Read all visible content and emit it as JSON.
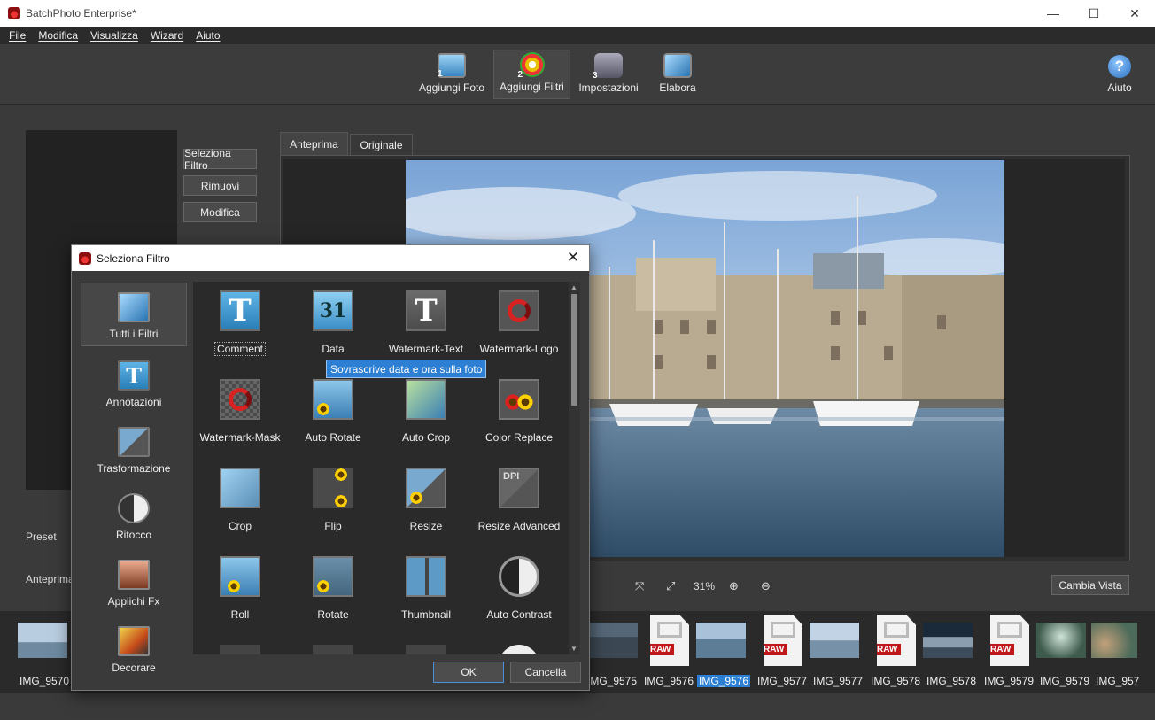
{
  "window": {
    "title": "BatchPhoto Enterprise*",
    "min": "—",
    "max": "☐",
    "close": "✕"
  },
  "menu": [
    "File",
    "Modifica",
    "Visualizza",
    "Wizard",
    "Aiuto"
  ],
  "toolbar": {
    "steps": [
      {
        "num": "1",
        "label": "Aggiungi Foto"
      },
      {
        "num": "2",
        "label": "Aggiungi Filtri"
      },
      {
        "num": "3",
        "label": "Impostazioni"
      },
      {
        "num": "",
        "label": "Elabora"
      }
    ],
    "help_label": "Aiuto",
    "help_glyph": "?"
  },
  "side_buttons": {
    "select": "Seleziona Filtro",
    "remove": "Rimuovi",
    "edit": "Modifica"
  },
  "labels": {
    "preset": "Preset",
    "preview": "Anteprima"
  },
  "tabs": [
    "Anteprima",
    "Originale"
  ],
  "zoom": {
    "fit1": "⤧",
    "fit2": "⤢",
    "percent": "31%",
    "zoom_in": "⊕",
    "zoom_out": "⊖"
  },
  "cambia_vista": "Cambia Vista",
  "thumbnails": [
    {
      "label": "IMG_9570",
      "raw": false,
      "selected": false
    },
    {
      "label": "IMG_9575",
      "raw": false,
      "selected": false
    },
    {
      "label": "IMG_9576",
      "raw": true,
      "selected": false
    },
    {
      "label": "IMG_9576",
      "raw": false,
      "selected": true
    },
    {
      "label": "IMG_9577",
      "raw": true,
      "selected": false
    },
    {
      "label": "IMG_9577",
      "raw": false,
      "selected": false
    },
    {
      "label": "IMG_9578",
      "raw": true,
      "selected": false
    },
    {
      "label": "IMG_9578",
      "raw": false,
      "selected": false
    },
    {
      "label": "IMG_9579",
      "raw": true,
      "selected": false
    },
    {
      "label": "IMG_9579",
      "raw": false,
      "selected": false
    },
    {
      "label": "IMG_957",
      "raw": false,
      "selected": false
    }
  ],
  "raw_tag": "RAW",
  "dialog": {
    "title": "Seleziona Filtro",
    "close": "✕",
    "categories": [
      "Tutti i Filtri",
      "Annotazioni",
      "Trasformazione",
      "Ritocco",
      "Applichi Fx",
      "Decorare"
    ],
    "filters": [
      "Comment",
      "Data",
      "Watermark-Text",
      "Watermark-Logo",
      "Watermark-Mask",
      "Auto Rotate",
      "Auto Crop",
      "Color Replace",
      "Crop",
      "Flip",
      "Resize",
      "Resize Advanced",
      "Roll",
      "Rotate",
      "Thumbnail",
      "Auto Contrast"
    ],
    "icon_text": {
      "comment": "T",
      "data": "31",
      "watermark_text": "T",
      "dpi": "DPI"
    },
    "tooltip": "Sovrascrive data e ora sulla foto",
    "ok": "OK",
    "cancel": "Cancella"
  }
}
